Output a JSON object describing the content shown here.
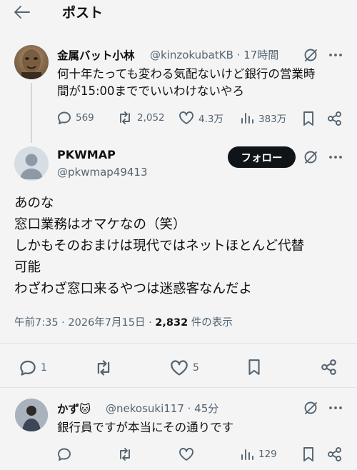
{
  "header": {
    "title": "ポスト"
  },
  "parent_post": {
    "name": "金属バット小林",
    "handle": "@kinzokubatKB · 17時間",
    "text_line1": "何十年たっても変わる気配ないけど銀行の営業時",
    "text_line2": "間が15:00まででいいわけないやろ",
    "replies": "569",
    "reposts": "2,052",
    "likes": "4.3万",
    "views": "383万"
  },
  "main_post": {
    "name": "PKWMAP",
    "handle": "@pkwmap49413",
    "follow_label": "フォロー",
    "text_lines": [
      "あのな",
      "窓口業務はオマケなの（笑）",
      "しかもそのおまけは現代ではネットほとんど代替",
      "可能",
      "わざわざ窓口来るやつは迷惑客なんだよ"
    ],
    "timestamp": "午前7:35 · 2026年7月15日 · ",
    "views_count": "2,832",
    "views_suffix": " 件の表示",
    "replies": "1",
    "likes": "5"
  },
  "reply_post": {
    "name": "かず🐱",
    "handle": "@nekosuki117 · 45分",
    "text": "銀行員ですが本当にその通りです",
    "views": "129"
  },
  "colors": {
    "icon": "#536471",
    "follow_bg": "#0f1419",
    "background": "#f4f4f5"
  },
  "icons": [
    "back-arrow-icon",
    "grok-icon",
    "more-icon",
    "reply-icon",
    "repost-icon",
    "like-icon",
    "views-icon",
    "bookmark-icon",
    "share-icon"
  ]
}
